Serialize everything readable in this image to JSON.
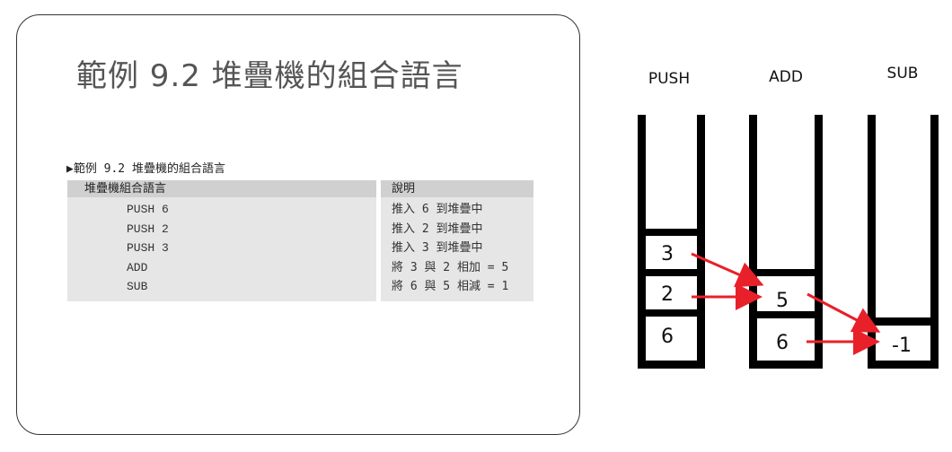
{
  "slide": {
    "title": "範例 9.2 堆疊機的組合語言",
    "caption": "▶範例 9.2 堆疊機的組合語言",
    "table": {
      "code_header": "堆疊機組合語言",
      "desc_header": "說明",
      "rows": [
        {
          "code": "PUSH 6",
          "desc": "推入 6 到堆疊中"
        },
        {
          "code": "PUSH 2",
          "desc": "推入 2 到堆疊中"
        },
        {
          "code": "PUSH 3",
          "desc": "推入 3 到堆疊中"
        },
        {
          "code": "ADD",
          "desc": "將 3 與 2 相加 = 5"
        },
        {
          "code": "SUB",
          "desc": "將 6 與 5 相減 = 1"
        }
      ]
    }
  },
  "diagram": {
    "stacks": [
      {
        "label": "PUSH",
        "cells": [
          "3",
          "2",
          "6"
        ]
      },
      {
        "label": "ADD",
        "cells": [
          "5",
          "6"
        ]
      },
      {
        "label": "SUB",
        "cells": [
          "-1"
        ]
      }
    ],
    "colors": {
      "stack": "#000000",
      "arrow": "#e8202a"
    }
  }
}
